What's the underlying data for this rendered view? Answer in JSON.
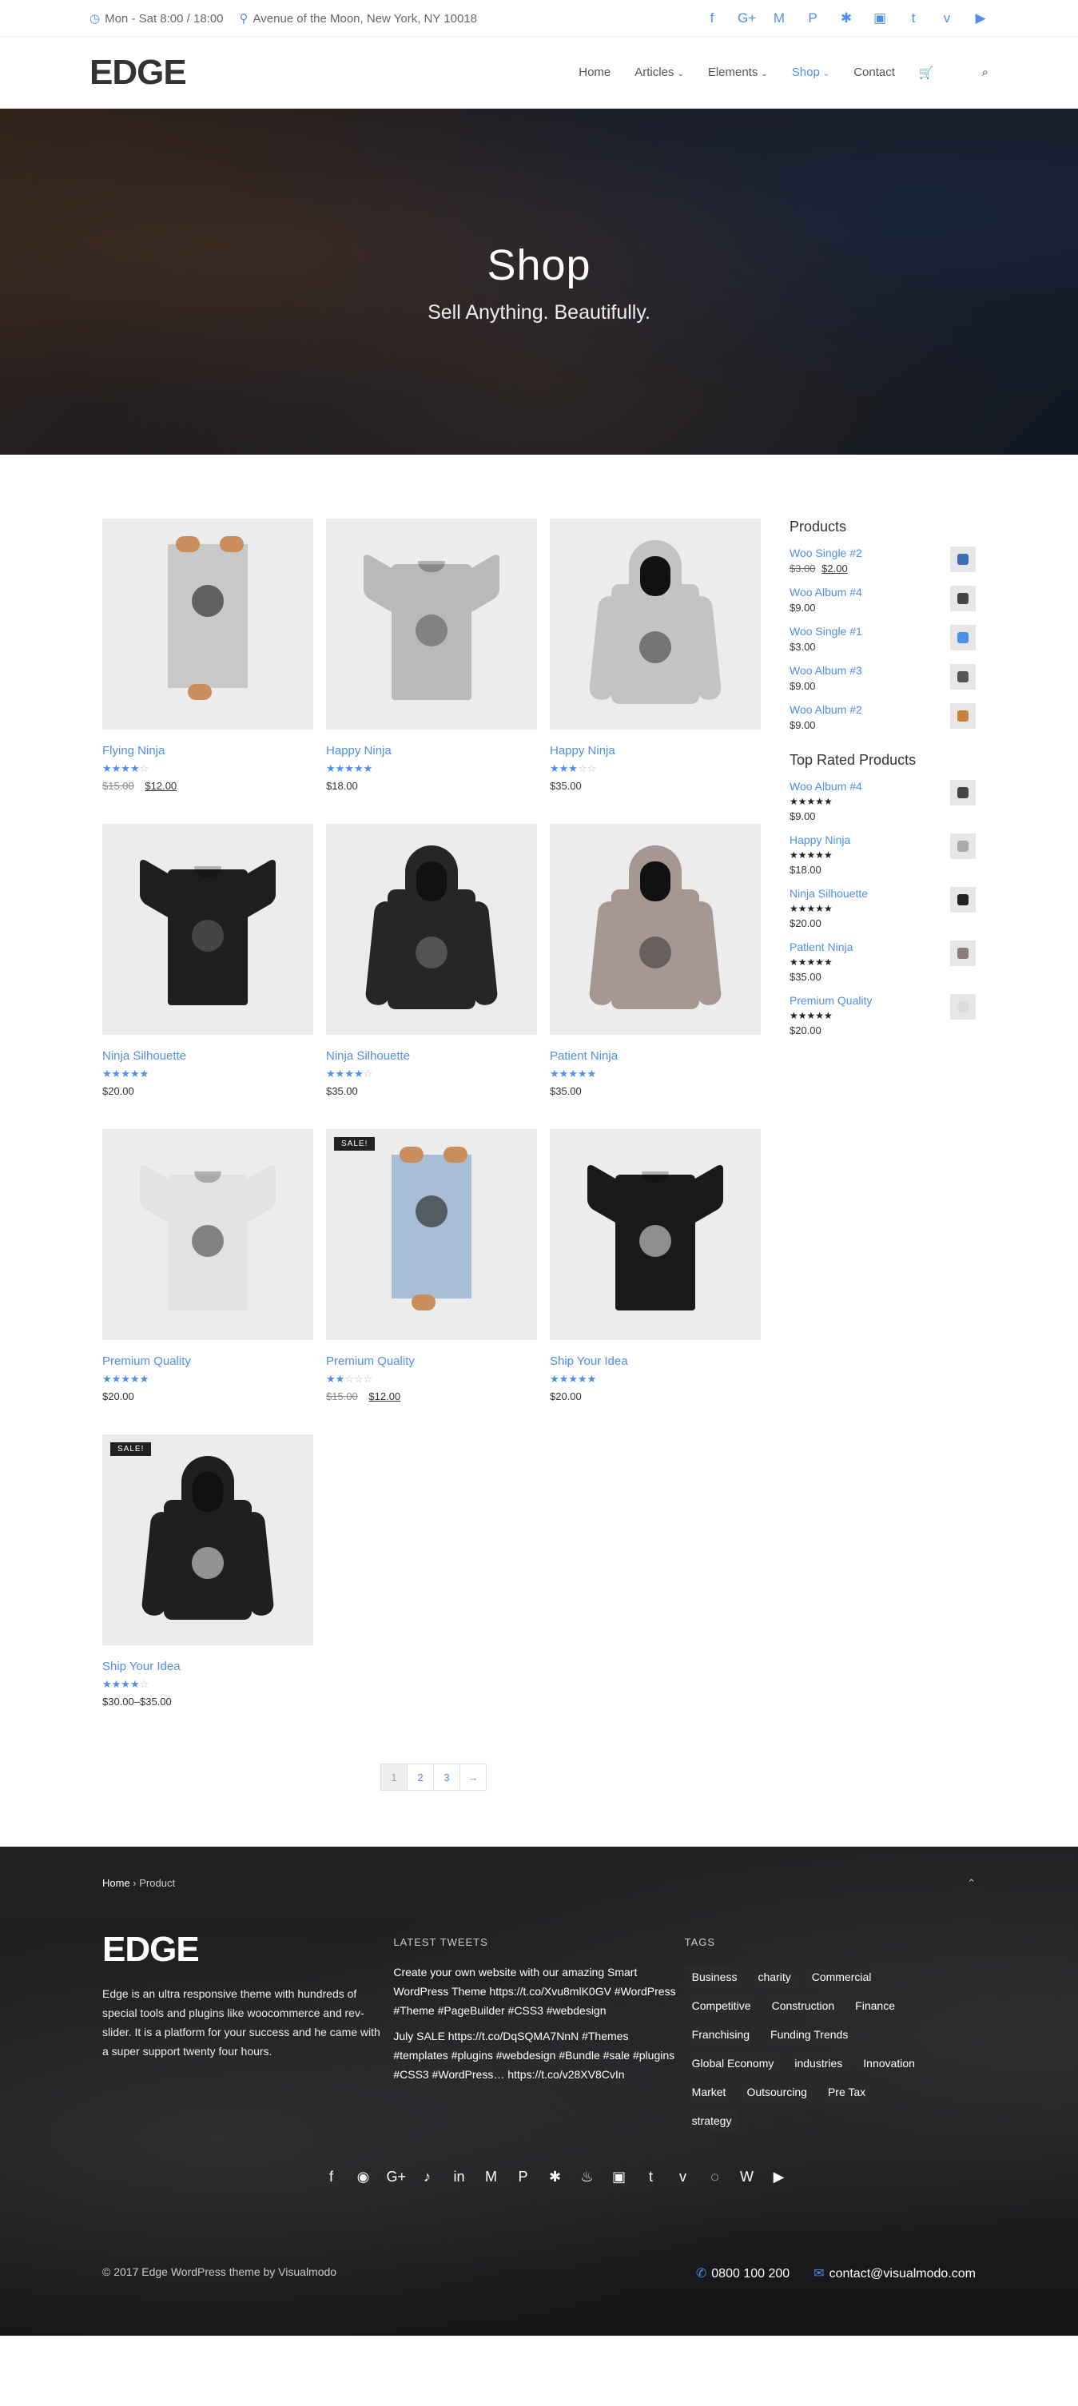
{
  "topbar": {
    "hours": "Mon - Sat 8:00 / 18:00",
    "address": "Avenue of the Moon, New York, NY 10018",
    "socials": [
      "f",
      "G+",
      "M",
      "P",
      "✱",
      "▣",
      "t",
      "v",
      "▶"
    ]
  },
  "header": {
    "logo": "EDGE",
    "nav": [
      {
        "label": "Home"
      },
      {
        "label": "Articles"
      },
      {
        "label": "Elements"
      },
      {
        "label": "Shop"
      },
      {
        "label": "Contact"
      }
    ]
  },
  "hero": {
    "title": "Shop",
    "subtitle": "Sell Anything. Beautifully."
  },
  "products": [
    {
      "name": "Flying Ninja",
      "rating": 4,
      "price_old": "$15.00",
      "price": "$12.00",
      "art": "poster-ninja",
      "sale": ""
    },
    {
      "name": "Happy Ninja",
      "rating": 5,
      "price_old": "",
      "price": "$18.00",
      "art": "tee-grey",
      "sale": ""
    },
    {
      "name": "Happy Ninja",
      "rating": 3,
      "price_old": "",
      "price": "$35.00",
      "art": "hood-grey",
      "sale": ""
    },
    {
      "name": "Ninja Silhouette",
      "rating": 5,
      "price_old": "",
      "price": "$20.00",
      "art": "tee-black",
      "sale": ""
    },
    {
      "name": "Ninja Silhouette",
      "rating": 4,
      "price_old": "",
      "price": "$35.00",
      "art": "hood-black",
      "sale": ""
    },
    {
      "name": "Patient Ninja",
      "rating": 5,
      "price_old": "",
      "price": "$35.00",
      "art": "hood-taupe",
      "sale": ""
    },
    {
      "name": "Premium Quality",
      "rating": 4.5,
      "price_old": "",
      "price": "$20.00",
      "art": "tee-white",
      "sale": ""
    },
    {
      "name": "Premium Quality",
      "rating": 2,
      "price_old": "$15.00",
      "price": "$12.00",
      "art": "poster-woo",
      "sale": "SALE!"
    },
    {
      "name": "Ship Your Idea",
      "rating": 4.5,
      "price_old": "",
      "price": "$20.00",
      "art": "tee-skull",
      "sale": ""
    },
    {
      "name": "Ship Your Idea",
      "rating": 4,
      "price_old": "",
      "price": "$30.00–$35.00",
      "art": "hood-skull",
      "sale": "SALE!"
    }
  ],
  "sidebar": {
    "products_title": "Products",
    "products": [
      {
        "name": "Woo Single #2",
        "price_old": "$3.00",
        "price": "$2.00",
        "color": "#3b6fb5"
      },
      {
        "name": "Woo Album #4",
        "price_old": "",
        "price": "$9.00",
        "color": "#444"
      },
      {
        "name": "Woo Single #1",
        "price_old": "",
        "price": "$3.00",
        "color": "#4f8ee9"
      },
      {
        "name": "Woo Album #3",
        "price_old": "",
        "price": "$9.00",
        "color": "#555"
      },
      {
        "name": "Woo Album #2",
        "price_old": "",
        "price": "$9.00",
        "color": "#c9803b"
      }
    ],
    "top_rated_title": "Top Rated Products",
    "top_rated": [
      {
        "name": "Woo Album #4",
        "rating": 5,
        "price": "$9.00",
        "color": "#444"
      },
      {
        "name": "Happy Ninja",
        "rating": 5,
        "price": "$18.00",
        "color": "#aaa"
      },
      {
        "name": "Ninja Silhouette",
        "rating": 5,
        "price": "$20.00",
        "color": "#222"
      },
      {
        "name": "Patient Ninja",
        "rating": 5,
        "price": "$35.00",
        "color": "#8a7d78"
      },
      {
        "name": "Premium Quality",
        "rating": 4.5,
        "price": "$20.00",
        "color": "#ddd"
      }
    ]
  },
  "pagination": {
    "pages": [
      "1",
      "2",
      "3"
    ],
    "next": "→",
    "current": "1"
  },
  "footer": {
    "breadcrumb_home": "Home",
    "breadcrumb_sep": " › ",
    "breadcrumb_current": "Product",
    "scroll_top": "⌃",
    "logo": "EDGE",
    "about": "Edge is an ultra responsive theme with hundreds of special tools and plugins like woocommerce and rev-slider. It is a platform for your success and he came with a super support twenty four hours.",
    "tweets_title": "LATEST TWEETS",
    "tweets": [
      "Create your own website with our amazing Smart WordPress Theme https://t.co/Xvu8mlK0GV #WordPress #Theme #PageBuilder #CSS3 #webdesign",
      "July SALE https://t.co/DqSQMA7NnN #Themes #templates #plugins #webdesign #Bundle #sale #plugins #CSS3 #WordPress… https://t.co/v28XV8CvIn"
    ],
    "tags_title": "TAGS",
    "tags": [
      "Business",
      "charity",
      "Commercial",
      "Competitive",
      "Construction",
      "Finance",
      "Franchising",
      "Funding Trends",
      "Global Economy",
      "industries",
      "Innovation",
      "Market",
      "Outsourcing",
      "Pre Tax",
      "strategy"
    ],
    "socials": [
      "",
      "f",
      "◉",
      "G+",
      "♪",
      "in",
      "M",
      "P",
      "✱",
      "♨",
      "▣",
      "t",
      "v",
      "◌",
      "W",
      "▶"
    ],
    "copyright": "© 2017 Edge WordPress theme by Visualmodo",
    "phone": "0800 100 200",
    "email": "contact@visualmodo.com"
  },
  "colors": {
    "accent": "#4f8ee9",
    "tag_bg": "#2a2a2a"
  }
}
